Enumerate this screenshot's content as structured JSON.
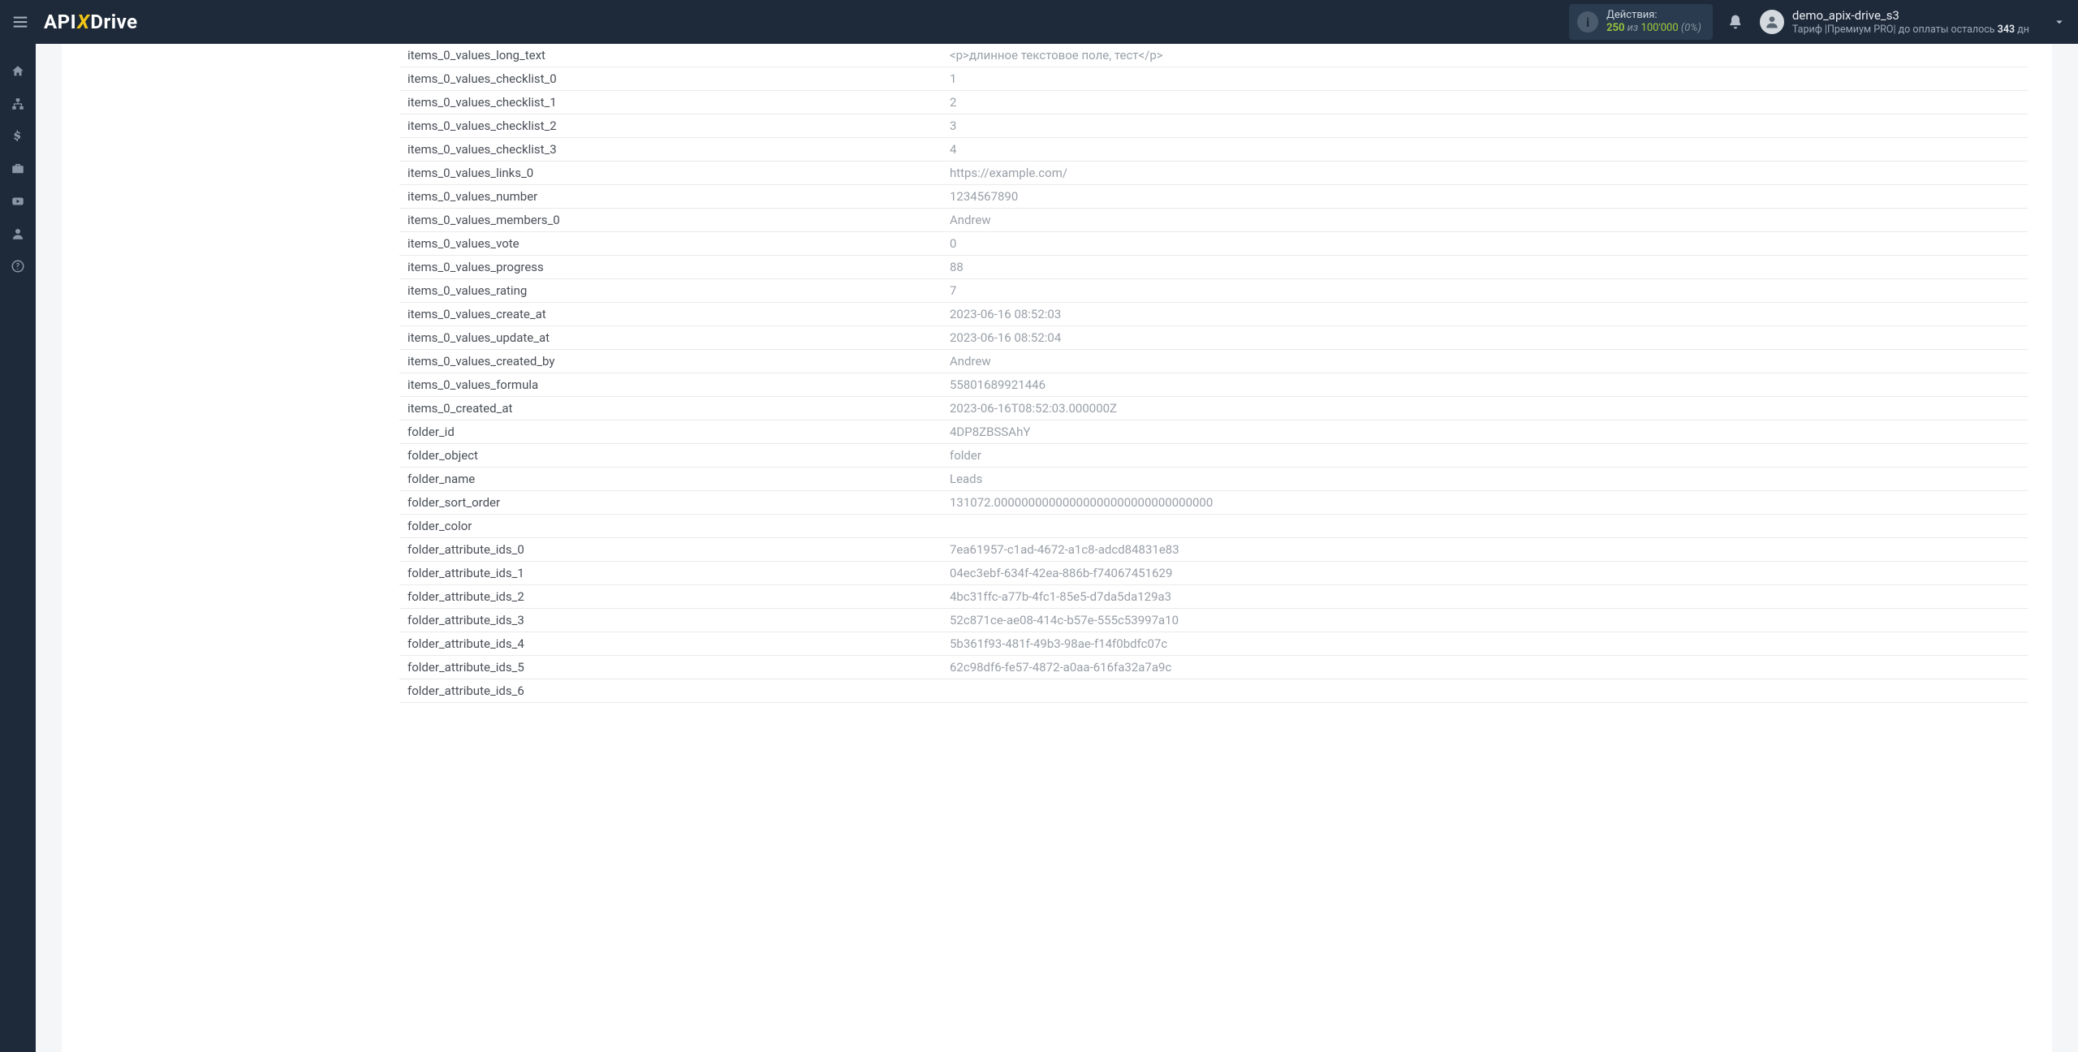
{
  "header": {
    "actions_label": "Действия:",
    "actions_used": "250",
    "actions_of": "из",
    "actions_total": "100'000",
    "actions_pct": "(0%)",
    "user_name": "demo_apix-drive_s3",
    "tariff_prefix": "Тариф |",
    "tariff_name": "Премиум PRO",
    "tariff_sep": "|",
    "tariff_pay_text": "до оплаты осталось",
    "tariff_days": "343",
    "tariff_days_suffix": "дн"
  },
  "logo": {
    "api": "API",
    "x": "X",
    "drive": "Drive"
  },
  "rows": [
    {
      "k": "items_0_values_long_text",
      "v": "<p>длинное текстовое поле, тест</p>"
    },
    {
      "k": "items_0_values_checklist_0",
      "v": "1"
    },
    {
      "k": "items_0_values_checklist_1",
      "v": "2"
    },
    {
      "k": "items_0_values_checklist_2",
      "v": "3"
    },
    {
      "k": "items_0_values_checklist_3",
      "v": "4"
    },
    {
      "k": "items_0_values_links_0",
      "v": "https://example.com/"
    },
    {
      "k": "items_0_values_number",
      "v": "1234567890"
    },
    {
      "k": "items_0_values_members_0",
      "v": "Andrew"
    },
    {
      "k": "items_0_values_vote",
      "v": "0"
    },
    {
      "k": "items_0_values_progress",
      "v": "88"
    },
    {
      "k": "items_0_values_rating",
      "v": "7"
    },
    {
      "k": "items_0_values_create_at",
      "v": "2023-06-16 08:52:03"
    },
    {
      "k": "items_0_values_update_at",
      "v": "2023-06-16 08:52:04"
    },
    {
      "k": "items_0_values_created_by",
      "v": "Andrew"
    },
    {
      "k": "items_0_values_formula",
      "v": "55801689921446"
    },
    {
      "k": "items_0_created_at",
      "v": "2023-06-16T08:52:03.000000Z"
    },
    {
      "k": "folder_id",
      "v": "4DP8ZBSSAhY"
    },
    {
      "k": "folder_object",
      "v": "folder"
    },
    {
      "k": "folder_name",
      "v": "Leads"
    },
    {
      "k": "folder_sort_order",
      "v": "131072.00000000000000000000000000000000"
    },
    {
      "k": "folder_color",
      "v": ""
    },
    {
      "k": "folder_attribute_ids_0",
      "v": "7ea61957-c1ad-4672-a1c8-adcd84831e83"
    },
    {
      "k": "folder_attribute_ids_1",
      "v": "04ec3ebf-634f-42ea-886b-f74067451629"
    },
    {
      "k": "folder_attribute_ids_2",
      "v": "4bc31ffc-a77b-4fc1-85e5-d7da5da129a3"
    },
    {
      "k": "folder_attribute_ids_3",
      "v": "52c871ce-ae08-414c-b57e-555c53997a10"
    },
    {
      "k": "folder_attribute_ids_4",
      "v": "5b361f93-481f-49b3-98ae-f14f0bdfc07c"
    },
    {
      "k": "folder_attribute_ids_5",
      "v": "62c98df6-fe57-4872-a0aa-616fa32a7a9c"
    },
    {
      "k": "folder_attribute_ids_6",
      "v": ""
    }
  ]
}
